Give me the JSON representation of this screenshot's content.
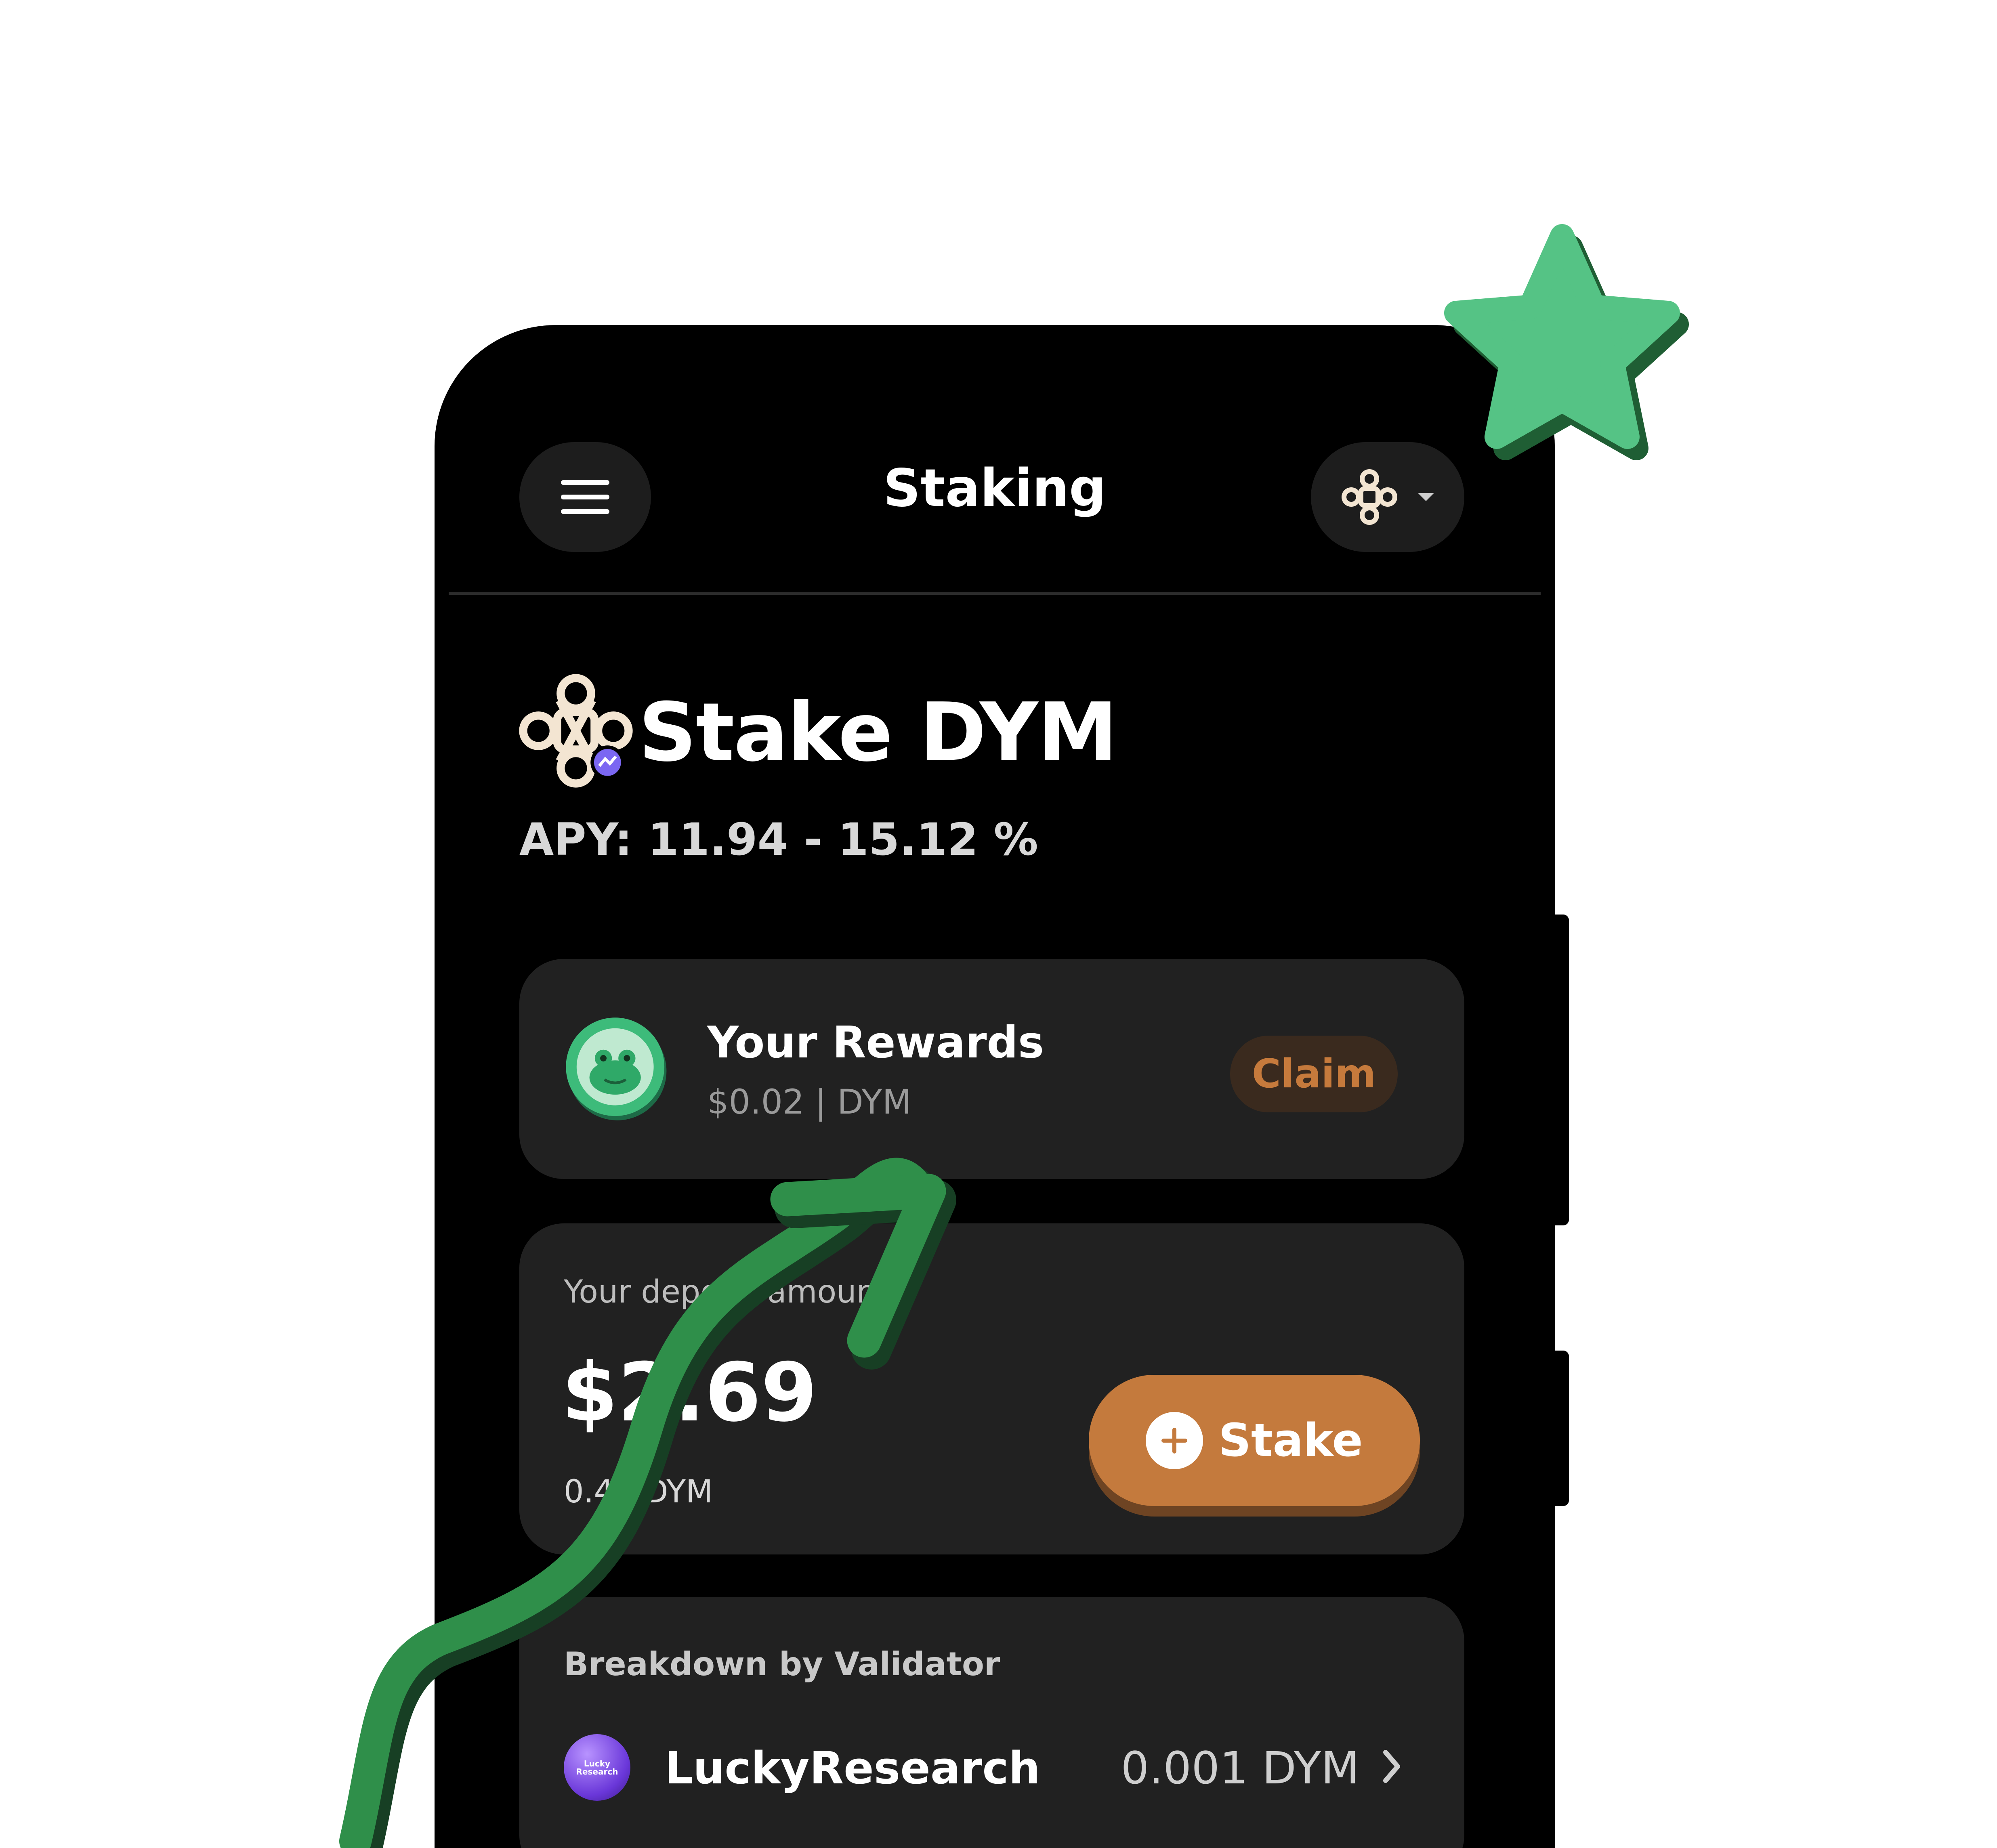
{
  "header": {
    "title": "Staking",
    "menu_icon": "hamburger-menu-icon",
    "chain_icon": "dymension-logo-icon",
    "chain_dropdown_icon": "caret-down-icon"
  },
  "hero": {
    "title": "Stake DYM",
    "apy": "APY: 11.94 - 15.12 %",
    "logo_icon": "dymension-logo-icon"
  },
  "rewards": {
    "title": "Your Rewards",
    "subtitle": "$0.02 | DYM",
    "claim_label": "Claim",
    "avatar_icon": "frog-avatar-icon"
  },
  "deposit": {
    "label": "Your deposit amount",
    "value": "$2.69",
    "sub": "0.42 DYM",
    "stake_label": "Stake",
    "stake_icon": "plus-circle-icon"
  },
  "breakdown": {
    "label": "Breakdown by Validator",
    "validators": [
      {
        "name": "LuckyResearch",
        "amount": "0.001 DYM",
        "avatar_text_1": "Lucky",
        "avatar_text_2": "Research"
      }
    ]
  },
  "colors": {
    "background": "#ffffff",
    "phone": "#000000",
    "card": "#212121",
    "accent_orange": "#c47a3d",
    "accent_green": "#35a865"
  },
  "decorations": {
    "star_icon": "green-star-icon",
    "arrow_icon": "green-arrow-icon"
  }
}
